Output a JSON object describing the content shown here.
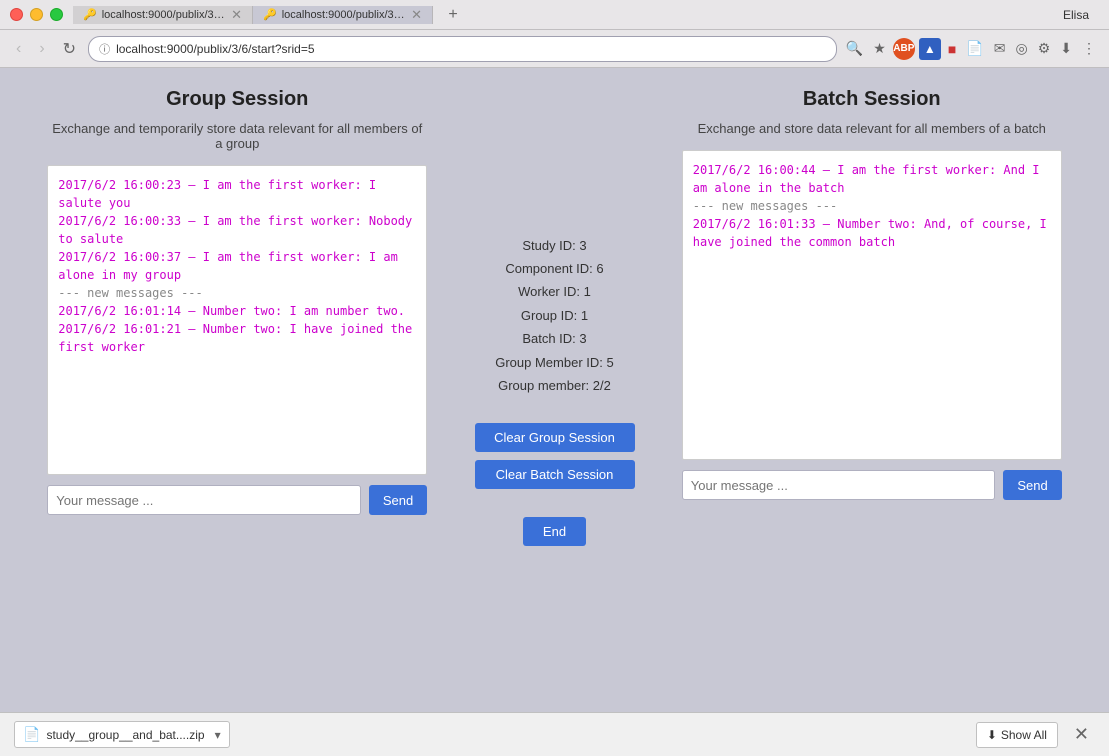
{
  "titlebar": {
    "user": "Elisa",
    "tabs": [
      {
        "id": "tab1",
        "favicon": "🔑",
        "title": "localhost:9000/publix/3/6/sta...",
        "active": false
      },
      {
        "id": "tab2",
        "favicon": "🔑",
        "title": "localhost:9000/publix/3/6/sta...",
        "active": true
      }
    ],
    "new_tab_icon": "+"
  },
  "navbar": {
    "back_label": "‹",
    "forward_label": "›",
    "refresh_label": "↻",
    "url": "localhost:9000/publix/3/6/start?srid=5",
    "lock_icon": "ⓘ"
  },
  "group_session": {
    "title": "Group Session",
    "subtitle": "Exchange and temporarily store data relevant for all members of a group",
    "messages": [
      {
        "text": "2017/6/2 16:00:23 – I am the first worker: I salute you"
      },
      {
        "text": "2017/6/2 16:00:33 – I am the first worker: Nobody to salute"
      },
      {
        "text": "2017/6/2 16:00:37 – I am the first worker: I am alone in my group"
      },
      {
        "separator": "--- new messages ---"
      },
      {
        "text": "2017/6/2 16:01:14 – Number two: I am number two."
      },
      {
        "text": "2017/6/2 16:01:21 – Number two: I have joined the first worker"
      }
    ],
    "input_placeholder": "Your message ...",
    "send_label": "Send"
  },
  "center_panel": {
    "study_id_label": "Study ID:",
    "study_id_value": "3",
    "component_id_label": "Component ID:",
    "component_id_value": "6",
    "worker_id_label": "Worker ID:",
    "worker_id_value": "1",
    "group_id_label": "Group ID:",
    "group_id_value": "1",
    "batch_id_label": "Batch ID:",
    "batch_id_value": "3",
    "group_member_id_label": "Group Member ID:",
    "group_member_id_value": "5",
    "group_member_label": "Group member:",
    "group_member_value": "2/2",
    "clear_group_label": "Clear Group Session",
    "clear_batch_label": "Clear Batch Session",
    "end_label": "End"
  },
  "batch_session": {
    "title": "Batch Session",
    "subtitle": "Exchange and store data relevant for all members of a batch",
    "messages": [
      {
        "text": "2017/6/2 16:00:44 – I am the first worker: And I am alone in the batch"
      },
      {
        "separator": "--- new messages ---"
      },
      {
        "text": "2017/6/2 16:01:33 – Number two: And, of course, I have joined the common batch"
      }
    ],
    "input_placeholder": "Your message ...",
    "send_label": "Send"
  },
  "download_bar": {
    "file_icon": "📄",
    "file_name": "study__group__and_bat....zip",
    "file_arrow": "▾",
    "show_all_icon": "⬇",
    "show_all_label": "Show All",
    "close_icon": "✕"
  }
}
